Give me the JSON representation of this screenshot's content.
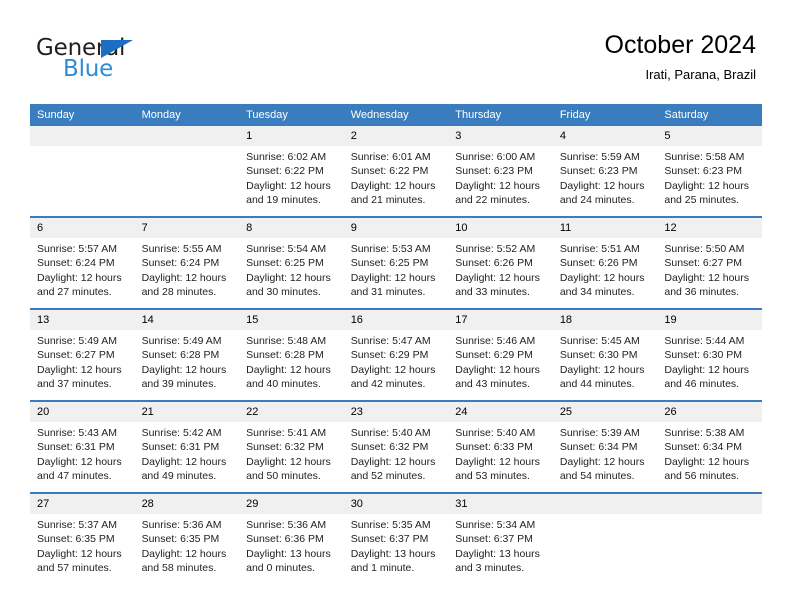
{
  "logo": {
    "word_top": "General",
    "word_bottom": "Blue",
    "triangle_icon": "triangle-icon",
    "color_dark": "#231f20",
    "color_blue": "#2e8bd6"
  },
  "header": {
    "title": "October 2024",
    "subtitle": "Irati, Parana, Brazil"
  },
  "theme": {
    "header_bg": "#3a7dbf",
    "daynum_bg": "#f0f0f0",
    "separator": "#3a7dbf"
  },
  "calendar": {
    "weekday_headers": [
      "Sunday",
      "Monday",
      "Tuesday",
      "Wednesday",
      "Thursday",
      "Friday",
      "Saturday"
    ],
    "weeks": [
      [
        {
          "day": "",
          "empty": true,
          "lines": []
        },
        {
          "day": "",
          "empty": true,
          "lines": []
        },
        {
          "day": "1",
          "lines": [
            "Sunrise: 6:02 AM",
            "Sunset: 6:22 PM",
            "Daylight: 12 hours",
            "and 19 minutes."
          ]
        },
        {
          "day": "2",
          "lines": [
            "Sunrise: 6:01 AM",
            "Sunset: 6:22 PM",
            "Daylight: 12 hours",
            "and 21 minutes."
          ]
        },
        {
          "day": "3",
          "lines": [
            "Sunrise: 6:00 AM",
            "Sunset: 6:23 PM",
            "Daylight: 12 hours",
            "and 22 minutes."
          ]
        },
        {
          "day": "4",
          "lines": [
            "Sunrise: 5:59 AM",
            "Sunset: 6:23 PM",
            "Daylight: 12 hours",
            "and 24 minutes."
          ]
        },
        {
          "day": "5",
          "lines": [
            "Sunrise: 5:58 AM",
            "Sunset: 6:23 PM",
            "Daylight: 12 hours",
            "and 25 minutes."
          ]
        }
      ],
      [
        {
          "day": "6",
          "lines": [
            "Sunrise: 5:57 AM",
            "Sunset: 6:24 PM",
            "Daylight: 12 hours",
            "and 27 minutes."
          ]
        },
        {
          "day": "7",
          "lines": [
            "Sunrise: 5:55 AM",
            "Sunset: 6:24 PM",
            "Daylight: 12 hours",
            "and 28 minutes."
          ]
        },
        {
          "day": "8",
          "lines": [
            "Sunrise: 5:54 AM",
            "Sunset: 6:25 PM",
            "Daylight: 12 hours",
            "and 30 minutes."
          ]
        },
        {
          "day": "9",
          "lines": [
            "Sunrise: 5:53 AM",
            "Sunset: 6:25 PM",
            "Daylight: 12 hours",
            "and 31 minutes."
          ]
        },
        {
          "day": "10",
          "lines": [
            "Sunrise: 5:52 AM",
            "Sunset: 6:26 PM",
            "Daylight: 12 hours",
            "and 33 minutes."
          ]
        },
        {
          "day": "11",
          "lines": [
            "Sunrise: 5:51 AM",
            "Sunset: 6:26 PM",
            "Daylight: 12 hours",
            "and 34 minutes."
          ]
        },
        {
          "day": "12",
          "lines": [
            "Sunrise: 5:50 AM",
            "Sunset: 6:27 PM",
            "Daylight: 12 hours",
            "and 36 minutes."
          ]
        }
      ],
      [
        {
          "day": "13",
          "lines": [
            "Sunrise: 5:49 AM",
            "Sunset: 6:27 PM",
            "Daylight: 12 hours",
            "and 37 minutes."
          ]
        },
        {
          "day": "14",
          "lines": [
            "Sunrise: 5:49 AM",
            "Sunset: 6:28 PM",
            "Daylight: 12 hours",
            "and 39 minutes."
          ]
        },
        {
          "day": "15",
          "lines": [
            "Sunrise: 5:48 AM",
            "Sunset: 6:28 PM",
            "Daylight: 12 hours",
            "and 40 minutes."
          ]
        },
        {
          "day": "16",
          "lines": [
            "Sunrise: 5:47 AM",
            "Sunset: 6:29 PM",
            "Daylight: 12 hours",
            "and 42 minutes."
          ]
        },
        {
          "day": "17",
          "lines": [
            "Sunrise: 5:46 AM",
            "Sunset: 6:29 PM",
            "Daylight: 12 hours",
            "and 43 minutes."
          ]
        },
        {
          "day": "18",
          "lines": [
            "Sunrise: 5:45 AM",
            "Sunset: 6:30 PM",
            "Daylight: 12 hours",
            "and 44 minutes."
          ]
        },
        {
          "day": "19",
          "lines": [
            "Sunrise: 5:44 AM",
            "Sunset: 6:30 PM",
            "Daylight: 12 hours",
            "and 46 minutes."
          ]
        }
      ],
      [
        {
          "day": "20",
          "lines": [
            "Sunrise: 5:43 AM",
            "Sunset: 6:31 PM",
            "Daylight: 12 hours",
            "and 47 minutes."
          ]
        },
        {
          "day": "21",
          "lines": [
            "Sunrise: 5:42 AM",
            "Sunset: 6:31 PM",
            "Daylight: 12 hours",
            "and 49 minutes."
          ]
        },
        {
          "day": "22",
          "lines": [
            "Sunrise: 5:41 AM",
            "Sunset: 6:32 PM",
            "Daylight: 12 hours",
            "and 50 minutes."
          ]
        },
        {
          "day": "23",
          "lines": [
            "Sunrise: 5:40 AM",
            "Sunset: 6:32 PM",
            "Daylight: 12 hours",
            "and 52 minutes."
          ]
        },
        {
          "day": "24",
          "lines": [
            "Sunrise: 5:40 AM",
            "Sunset: 6:33 PM",
            "Daylight: 12 hours",
            "and 53 minutes."
          ]
        },
        {
          "day": "25",
          "lines": [
            "Sunrise: 5:39 AM",
            "Sunset: 6:34 PM",
            "Daylight: 12 hours",
            "and 54 minutes."
          ]
        },
        {
          "day": "26",
          "lines": [
            "Sunrise: 5:38 AM",
            "Sunset: 6:34 PM",
            "Daylight: 12 hours",
            "and 56 minutes."
          ]
        }
      ],
      [
        {
          "day": "27",
          "lines": [
            "Sunrise: 5:37 AM",
            "Sunset: 6:35 PM",
            "Daylight: 12 hours",
            "and 57 minutes."
          ]
        },
        {
          "day": "28",
          "lines": [
            "Sunrise: 5:36 AM",
            "Sunset: 6:35 PM",
            "Daylight: 12 hours",
            "and 58 minutes."
          ]
        },
        {
          "day": "29",
          "lines": [
            "Sunrise: 5:36 AM",
            "Sunset: 6:36 PM",
            "Daylight: 13 hours",
            "and 0 minutes."
          ]
        },
        {
          "day": "30",
          "lines": [
            "Sunrise: 5:35 AM",
            "Sunset: 6:37 PM",
            "Daylight: 13 hours",
            "and 1 minute."
          ]
        },
        {
          "day": "31",
          "lines": [
            "Sunrise: 5:34 AM",
            "Sunset: 6:37 PM",
            "Daylight: 13 hours",
            "and 3 minutes."
          ]
        },
        {
          "day": "",
          "empty": true,
          "lines": []
        },
        {
          "day": "",
          "empty": true,
          "lines": []
        }
      ]
    ]
  }
}
